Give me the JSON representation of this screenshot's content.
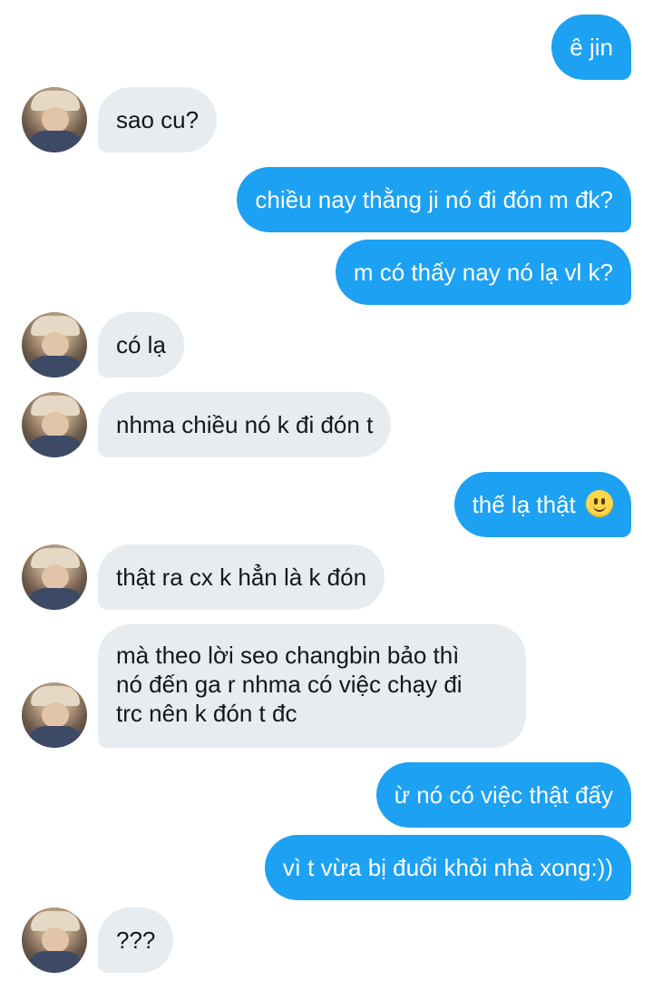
{
  "messages": [
    {
      "id": "m1",
      "from": "me",
      "text": "ê jin"
    },
    {
      "id": "m2",
      "from": "them",
      "text": "sao cu?"
    },
    {
      "id": "m3",
      "from": "me",
      "text": "chiều nay thằng ji nó đi đón m đk?"
    },
    {
      "id": "m4",
      "from": "me",
      "text": "m có thấy nay nó lạ vl k?"
    },
    {
      "id": "m5",
      "from": "them",
      "text": "có lạ"
    },
    {
      "id": "m6",
      "from": "them",
      "text": "nhma chiều nó k đi đón t"
    },
    {
      "id": "m7",
      "from": "me",
      "text": "thế lạ thật",
      "emoji": "slightly-smiling-face"
    },
    {
      "id": "m8",
      "from": "them",
      "text": "thật ra cx k hẳn là k đón"
    },
    {
      "id": "m9",
      "from": "them",
      "lines": [
        "mà theo lời seo changbin bảo thì",
        "nó đến ga r nhma có việc chạy đi",
        "trc nên k đón t đc"
      ]
    },
    {
      "id": "m10",
      "from": "me",
      "text": "ừ nó có việc thật đấy"
    },
    {
      "id": "m11",
      "from": "me",
      "text": "vì t vừa bị đuổi khỏi nhà xong:))"
    },
    {
      "id": "m12",
      "from": "them",
      "text": "???"
    }
  ],
  "colors": {
    "outgoing_bubble": "#1da1f2",
    "incoming_bubble": "#e6ecf0",
    "outgoing_text": "#ffffff",
    "incoming_text": "#14171a"
  }
}
